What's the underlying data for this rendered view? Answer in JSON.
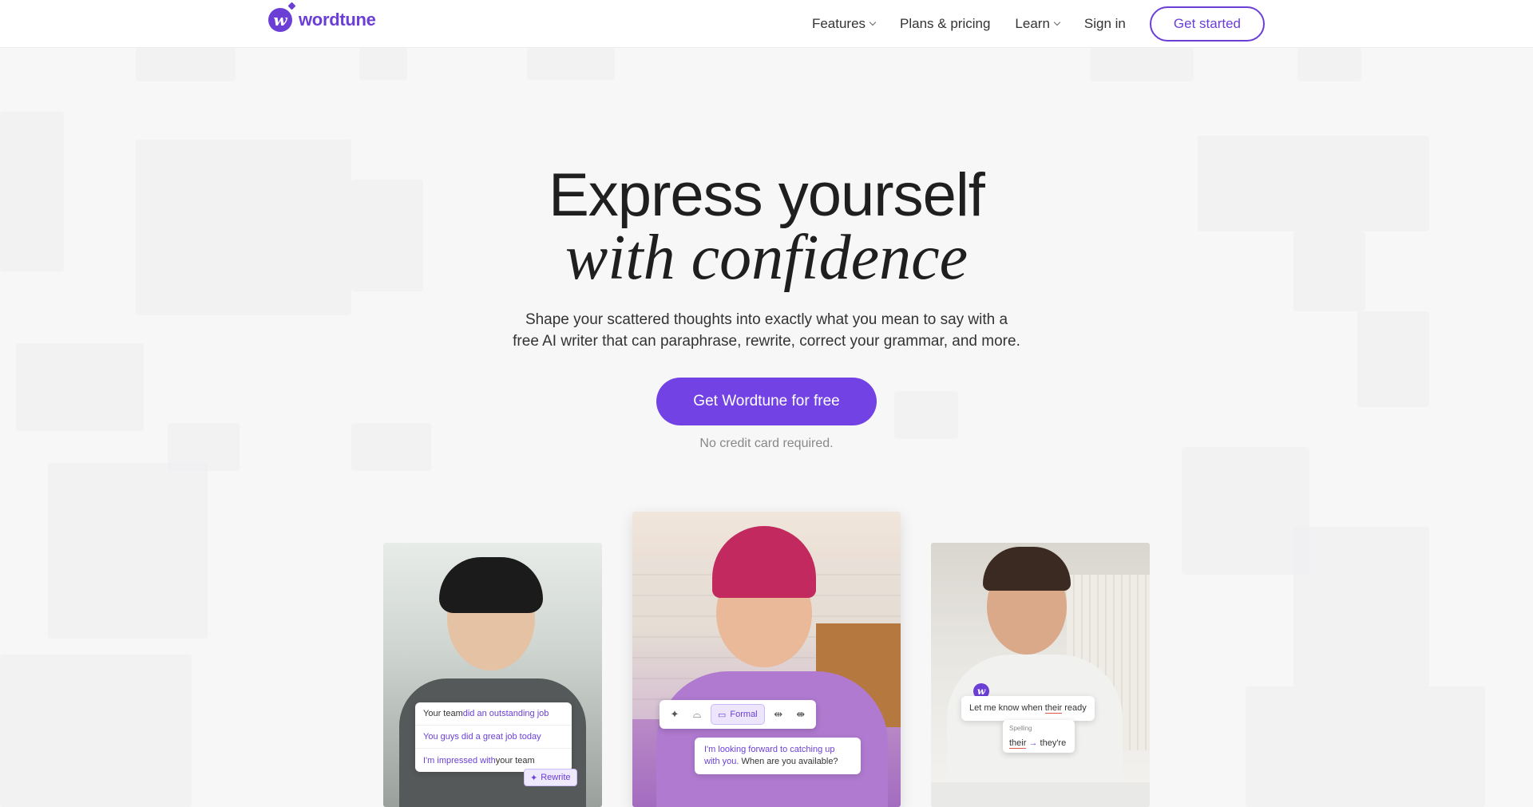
{
  "header": {
    "logo_text": "wordtune",
    "logo_letter": "w",
    "nav": [
      {
        "label": "Features",
        "has_dropdown": true
      },
      {
        "label": "Plans & pricing",
        "has_dropdown": false
      },
      {
        "label": "Learn",
        "has_dropdown": true
      },
      {
        "label": "Sign in",
        "has_dropdown": false
      }
    ],
    "get_started": "Get started"
  },
  "hero": {
    "title_line1": "Express yourself",
    "title_line2": "with confidence",
    "subtitle_line1": "Shape your scattered thoughts into exactly what you mean to say with a",
    "subtitle_line2": "free AI writer that can paraphrase, rewrite, correct your grammar, and more.",
    "cta": "Get Wordtune for free",
    "note": "No credit card required."
  },
  "cards": {
    "card1": {
      "suggestions": [
        {
          "plain": "Your team ",
          "highlight": "did an outstanding job"
        },
        {
          "plain": "",
          "highlight": "You guys did a great job today"
        },
        {
          "plain_after": "your team",
          "highlight": "I'm impressed with "
        }
      ],
      "rewrite": "Rewrite"
    },
    "card2": {
      "tone": "Formal",
      "message_highlight": "I'm looking forward to catching up with you.",
      "message_plain": " When are you available?"
    },
    "card3": {
      "badge": "w",
      "sentence_before": "Let me know when ",
      "sentence_error": "their",
      "sentence_after": " ready",
      "spelling_label": "Spelling",
      "from_word": "their",
      "arrow": "→",
      "to_word": "they're"
    }
  },
  "colors": {
    "brand": "#6b3fd6",
    "cta": "#7342e4"
  }
}
